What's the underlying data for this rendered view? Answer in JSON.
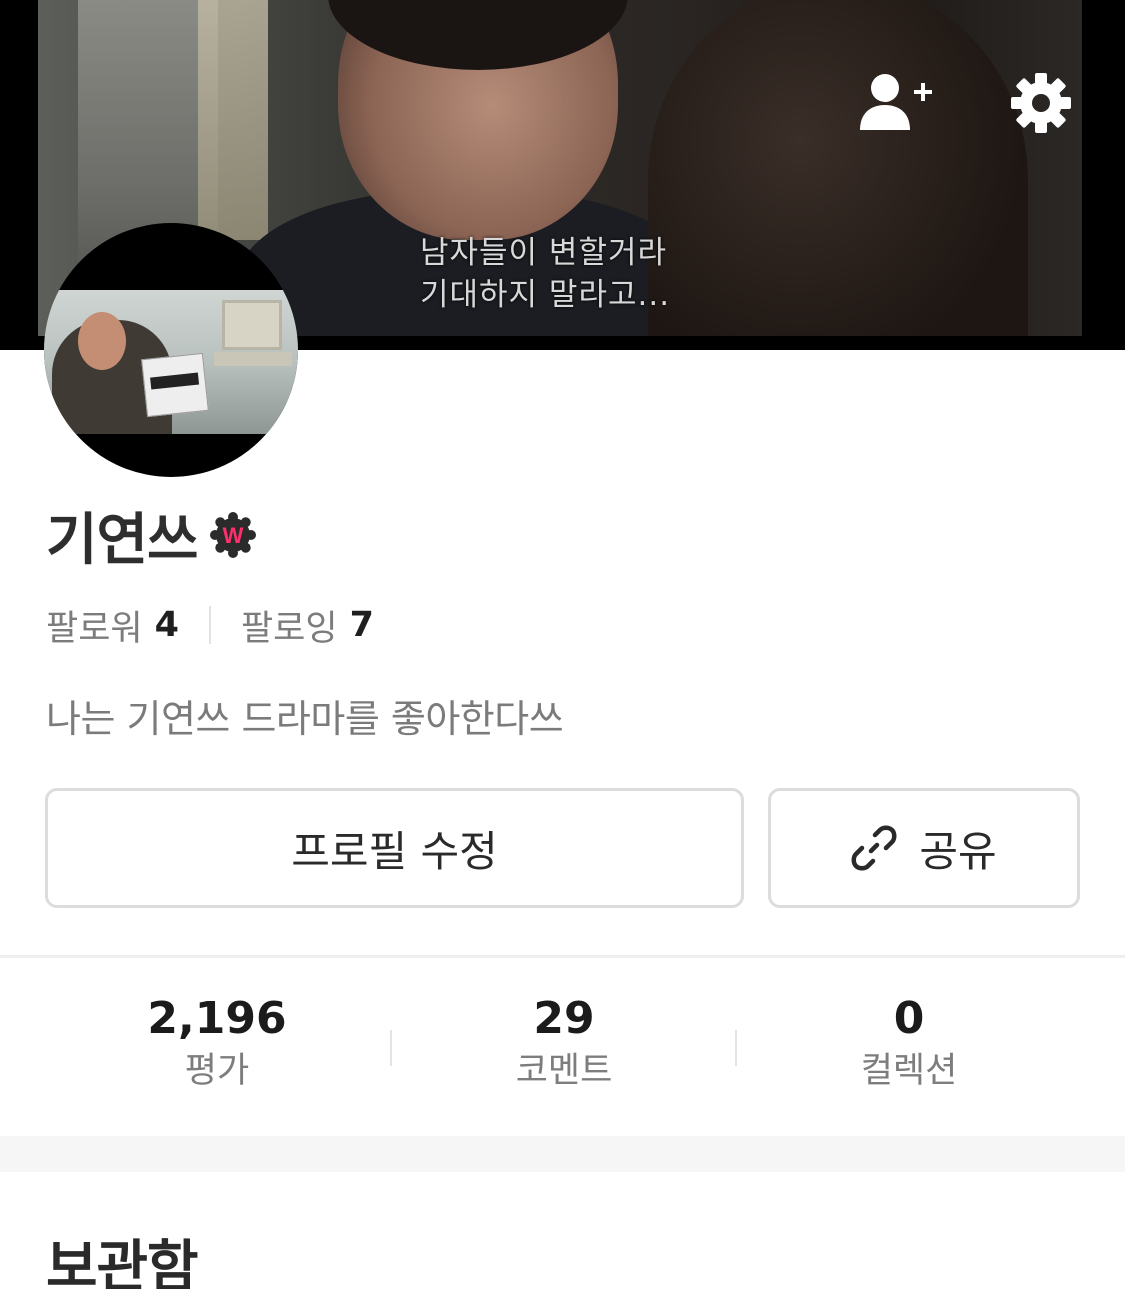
{
  "cover": {
    "subtitle_line1": "남자들이 변할거라",
    "subtitle_line2": "기대하지 말라고..."
  },
  "header_icons": {
    "add_friend": "add-user-icon",
    "settings": "gear-icon"
  },
  "profile": {
    "name": "기연쓰",
    "badge_letter": "W",
    "badge_color": "#ff2f6e",
    "followers_label": "팔로워",
    "followers_count": "4",
    "following_label": "팔로잉",
    "following_count": "7",
    "bio": "나는 기연쓰 드라마를 좋아한다쓰"
  },
  "actions": {
    "edit_label": "프로필 수정",
    "share_label": "공유"
  },
  "stats": [
    {
      "value": "2,196",
      "label": "평가"
    },
    {
      "value": "29",
      "label": "코멘트"
    },
    {
      "value": "0",
      "label": "컬렉션"
    }
  ],
  "section": {
    "title": "보관함"
  }
}
